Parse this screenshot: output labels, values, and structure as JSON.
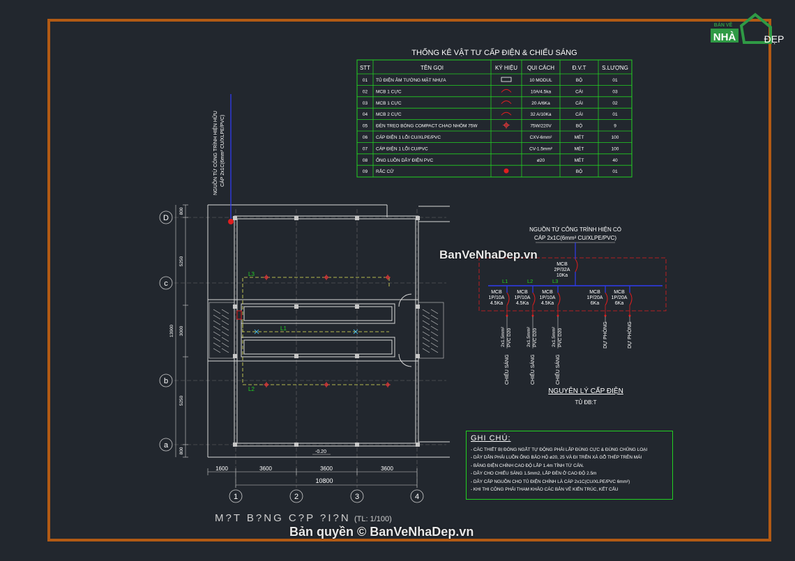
{
  "logo": {
    "top": "BẢN VẼ",
    "nha": "NHÀ",
    "dep": "ĐẸP"
  },
  "table": {
    "title": "THỐNG KÊ VẬT TƯ CẤP ĐIỆN & CHIẾU SÁNG",
    "headers": [
      "STT",
      "TÊN GỌI",
      "KÝ HIỆU",
      "QUI CÁCH",
      "Đ.V.T",
      "S.LƯỢNG"
    ],
    "rows": [
      {
        "stt": "01",
        "name": "TỦ ĐIỆN ÂM TƯỜNG MẶT NHỰA",
        "symbol": "panel",
        "spec": "10 MODUL",
        "unit": "BỘ",
        "qty": "01"
      },
      {
        "stt": "02",
        "name": "MCB 1 CỰC",
        "symbol": "mcb",
        "spec": "10A/4.5ka",
        "unit": "CÁI",
        "qty": "03"
      },
      {
        "stt": "03",
        "name": "MCB 1 CỰC",
        "symbol": "mcb",
        "spec": "20 A/6Ka",
        "unit": "CÁI",
        "qty": "02"
      },
      {
        "stt": "04",
        "name": "MCB 2 CỰC",
        "symbol": "mcb",
        "spec": "32 A/10Ka",
        "unit": "CÁI",
        "qty": "01"
      },
      {
        "stt": "05",
        "name": "ĐÈN TREO BÓNG COMPACT CHAO NHÔM 75W",
        "symbol": "lamp",
        "spec": "75W/220V",
        "unit": "BỘ",
        "qty": "9"
      },
      {
        "stt": "06",
        "name": "CÁP ĐIỆN 1 LỖI CU/XLPE/PVC",
        "symbol": "",
        "spec": "CXV-6mm²",
        "unit": "MÉT",
        "qty": "100"
      },
      {
        "stt": "07",
        "name": "CÁP ĐIỆN 1 LỖI CU/PVC",
        "symbol": "",
        "spec": "CV-1.5mm²",
        "unit": "MÉT",
        "qty": "100"
      },
      {
        "stt": "08",
        "name": "ỐNG LUỒN DÂY ĐIỆN PVC",
        "symbol": "",
        "spec": "ø20",
        "unit": "MÉT",
        "qty": "40"
      },
      {
        "stt": "09",
        "name": "RẮC CỬ",
        "symbol": "plug",
        "spec": "",
        "unit": "BỘ",
        "qty": "01"
      }
    ]
  },
  "plan": {
    "title": "M?T B?NG C?P ?I?N",
    "scale": "(TL: 1/100)",
    "source_label_1": "NGUỒN TỪ CÔNG TRÌNH HIỆN HỮU",
    "source_label_2": "CÁP 2x1C(6mm² CU/XLPE/PVC)",
    "row_axes": [
      "D",
      "c",
      "b",
      "a"
    ],
    "col_axes": [
      "1",
      "2",
      "3",
      "4"
    ],
    "dims_left": [
      "800",
      "5250",
      "13900",
      "3000",
      "5250",
      "800"
    ],
    "dims_bottom": [
      "1600",
      "3600",
      "3600",
      "3600"
    ],
    "dim_total": "10800",
    "level": "-0.20",
    "circuits": [
      "L3",
      "L1",
      "L2"
    ]
  },
  "schematic": {
    "source_1": "NGUỒN TỪ CÔNG TRÌNH HIỆN CÓ",
    "source_2": "CÁP 2x1C(6mm² CU/XLPE/PVC)",
    "main_mcb": [
      "MCB",
      "2P/32A",
      "10Ka"
    ],
    "lines": [
      "L1",
      "L2",
      "L3"
    ],
    "branches": [
      {
        "mcb": [
          "MCB",
          "1P/10A",
          "4.5Ka"
        ],
        "cable": [
          "2x1.5mm²",
          "PVC D20"
        ],
        "load": "CHIẾU SÁNG"
      },
      {
        "mcb": [
          "MCB",
          "1P/10A",
          "4.5Ka"
        ],
        "cable": [
          "2x1.5mm²",
          "PVC D20"
        ],
        "load": "CHIẾU SÁNG"
      },
      {
        "mcb": [
          "MCB",
          "1P/10A",
          "4.5Ka"
        ],
        "cable": [
          "2x1.5mm²",
          "PVC D20"
        ],
        "load": "CHIẾU SÁNG"
      },
      {
        "mcb": [
          "MCB",
          "1P/20A",
          "6Ka"
        ],
        "cable": [
          "",
          ""
        ],
        "load": "DỰ PHÒNG"
      },
      {
        "mcb": [
          "MCB",
          "1P/20A",
          "6Ka"
        ],
        "cable": [
          "",
          ""
        ],
        "load": "DỰ PHÒNG"
      }
    ],
    "title": "NGUYÊN LÝ CẤP ĐIỆN",
    "subtitle": "TỦ ĐB:T"
  },
  "notes": {
    "title": "GHI CHÚ:",
    "lines": [
      "- CÁC THIẾT BỊ ĐÓNG NGẮT TỰ ĐỘNG PHẢI LẮP ĐÚNG CỰC & ĐÚNG CHỦNG LOẠI",
      "- DÂY DẪN PHẢI LUỒN ỐNG BẢO HỘ ø20, 25 VÀ ĐI TRÊN XÀ GỖ THÉP TRÊN MÁI",
      "- BẢNG ĐIỆN CHÍNH CAO ĐỘ LẮP 1.4m TÍNH TỪ CẢN.",
      "- DÂY CHO CHIẾU SÁNG 1.5mm2, LẮP ĐÈN Ở CAO ĐỘ 2.5m",
      "- DÂY CẤP NGUỒN CHO TỦ ĐIỆN CHÍNH LÀ CÁP 2x1C(CU/XLPE/PVC 6mm²)",
      "- KHI THI CÔNG PHẢI THAM KHẢO CÁC BẢN VẼ KIẾN TRÚC, KẾT CẤU"
    ]
  },
  "watermark_1": "BanVeNhaDep.vn",
  "watermark_2": "Bản quyền © BanVeNhaDep.vn",
  "colors": {
    "frame": "#b25a14",
    "grid": "#22d022",
    "wire": "#2f3cf0",
    "mcb": "#e11e1e",
    "circuit": "#e8ea5a",
    "lamp": "#ff3a3a"
  }
}
